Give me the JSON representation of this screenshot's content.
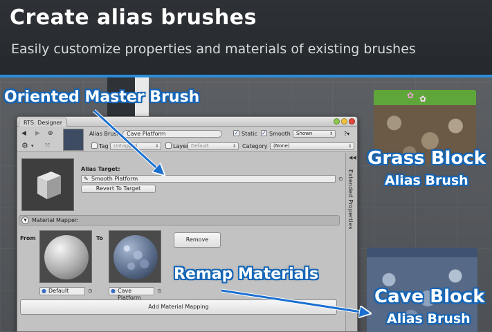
{
  "banner": {
    "title": "Create alias brushes",
    "subtitle": "Easily customize properties and materials of existing brushes"
  },
  "callouts": {
    "master": "Oriented Master Brush",
    "grass_title": "Grass Block",
    "grass_sub": "Alias Brush",
    "remap": "Remap Materials",
    "cave_title": "Cave Block",
    "cave_sub": "Alias Brush"
  },
  "window": {
    "tab": "RTS: Designer",
    "question_button": "?▾",
    "side_panel_label": "Extended Properties",
    "toolbar": {
      "alias_label": "Alias Brush",
      "alias_value": "Cave Platform",
      "static_label": "Static",
      "static_checked": true,
      "smooth_label": "Smooth",
      "smooth_checked": true,
      "visibility_value": "Shown",
      "tag_label": "Tag",
      "tag_value": "Untagged",
      "layer_label": "Layer",
      "layer_value": "Default",
      "category_label": "Category",
      "category_value": "(None)"
    },
    "alias_target": {
      "label": "Alias Target:",
      "value": "Smooth Platform",
      "revert_button": "Revert To Target"
    },
    "material_mapper": {
      "section_label": "Material Mapper:",
      "from_label": "From",
      "to_label": "To",
      "from_value": "Default",
      "to_value": "Cave Platform",
      "remove_button": "Remove",
      "add_button": "Add Material Mapping"
    }
  },
  "colors": {
    "accent_blue": "#2a8ddb",
    "callout_outline": "#1466b8",
    "arrow_blue": "#1a6fd0"
  },
  "icons": [
    "back-icon",
    "forward-icon",
    "locate-icon",
    "gear-icon",
    "move-icon",
    "object-icon",
    "target-icon",
    "material-icon"
  ]
}
